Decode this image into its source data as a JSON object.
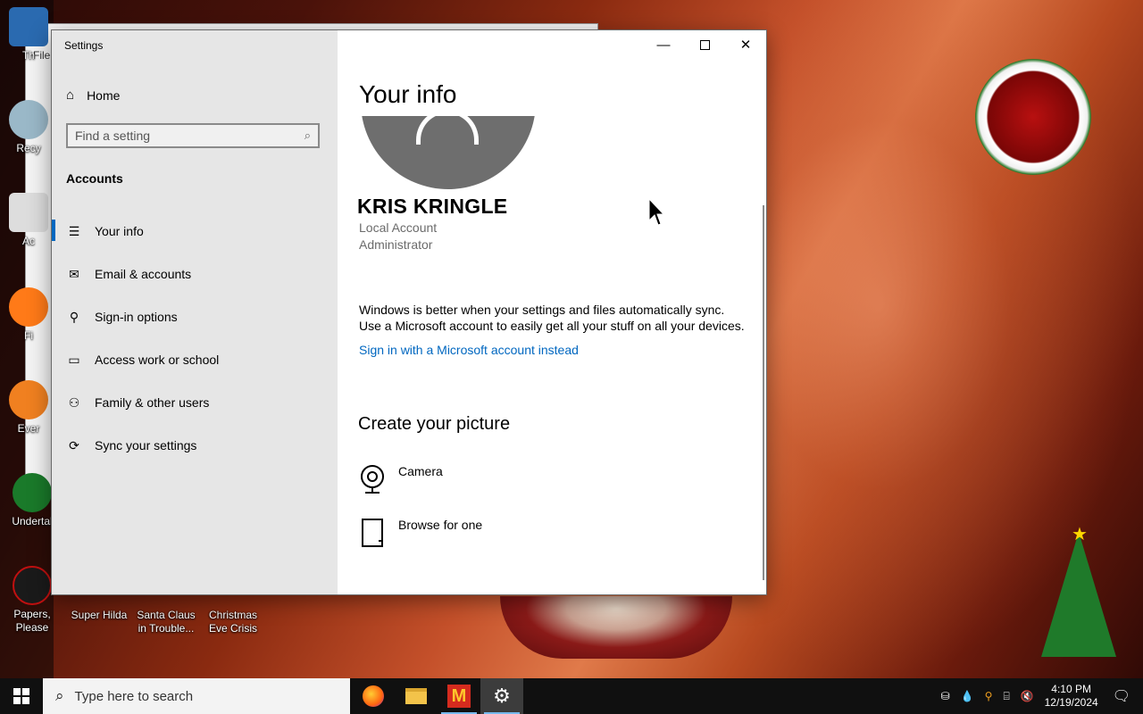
{
  "desktop": {
    "icons_left": [
      {
        "label": "Th",
        "top": 0
      },
      {
        "label": "Recy",
        "top": 0
      },
      {
        "label": "Ac",
        "top": 0
      },
      {
        "label": "Fi",
        "top": 0
      },
      {
        "label": "Ever",
        "top": 0
      },
      {
        "label": "Undertal",
        "top": 0
      }
    ],
    "icons_bottom": [
      {
        "label": "Papers, Please"
      },
      {
        "label": "Super Hilda"
      },
      {
        "label": "Santa Claus in Trouble..."
      },
      {
        "label": "Christmas Eve Crisis"
      }
    ],
    "bg_window_text": "File"
  },
  "settings": {
    "title": "Settings",
    "nav": {
      "home": "Home",
      "search_placeholder": "Find a setting",
      "section": "Accounts",
      "items": [
        {
          "label": "Your info",
          "icon": "person-card-icon"
        },
        {
          "label": "Email & accounts",
          "icon": "mail-icon"
        },
        {
          "label": "Sign-in options",
          "icon": "key-icon"
        },
        {
          "label": "Access work or school",
          "icon": "briefcase-icon"
        },
        {
          "label": "Family & other users",
          "icon": "person-add-icon"
        },
        {
          "label": "Sync your settings",
          "icon": "sync-icon"
        }
      ]
    },
    "content": {
      "heading": "Your info",
      "user_name": "KRIS KRINGLE",
      "account_type": "Local Account",
      "role": "Administrator",
      "sync_text_1": "Windows is better when your settings and files automatically sync.",
      "sync_text_2": "Use a Microsoft account to easily get all your stuff on all your devices.",
      "ms_link": "Sign in with a Microsoft account instead",
      "create_heading": "Create your picture",
      "options": [
        {
          "label": "Camera",
          "icon": "camera-icon"
        },
        {
          "label": "Browse for one",
          "icon": "file-icon"
        }
      ]
    }
  },
  "taskbar": {
    "search_placeholder": "Type here to search",
    "time": "4:10 PM",
    "date": "12/19/2024"
  },
  "colors": {
    "accent": "#0067c0",
    "nav_bg": "#e6e6e6",
    "taskbar_bg": "#101010"
  }
}
